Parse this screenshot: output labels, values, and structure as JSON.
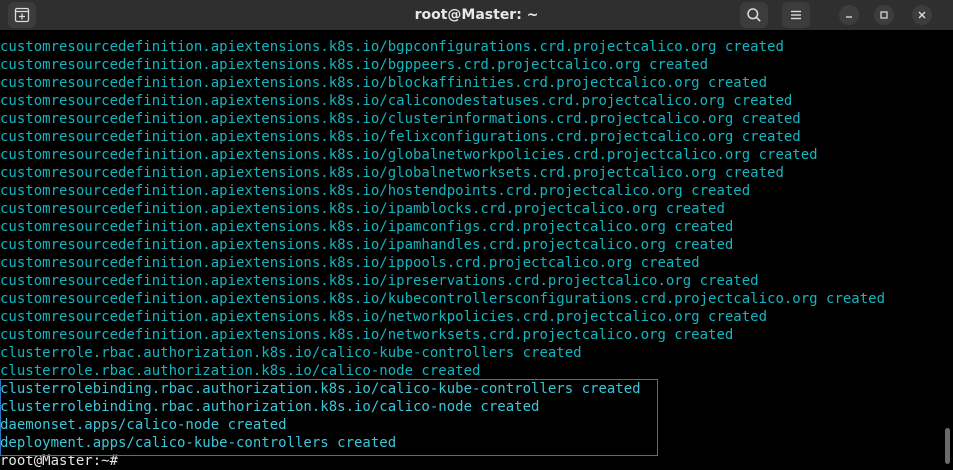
{
  "window": {
    "title": "root@Master: ~"
  },
  "toolbar": {
    "new_tab_icon": "new-tab-icon",
    "search_icon": "search-icon",
    "menu_icon": "hamburger-menu-icon",
    "minimize_icon": "minimize-icon",
    "maximize_icon": "maximize-icon",
    "close_icon": "close-icon"
  },
  "terminal": {
    "lines": [
      "customresourcedefinition.apiextensions.k8s.io/bgpconfigurations.crd.projectcalico.org created",
      "customresourcedefinition.apiextensions.k8s.io/bgppeers.crd.projectcalico.org created",
      "customresourcedefinition.apiextensions.k8s.io/blockaffinities.crd.projectcalico.org created",
      "customresourcedefinition.apiextensions.k8s.io/caliconodestatuses.crd.projectcalico.org created",
      "customresourcedefinition.apiextensions.k8s.io/clusterinformations.crd.projectcalico.org created",
      "customresourcedefinition.apiextensions.k8s.io/felixconfigurations.crd.projectcalico.org created",
      "customresourcedefinition.apiextensions.k8s.io/globalnetworkpolicies.crd.projectcalico.org created",
      "customresourcedefinition.apiextensions.k8s.io/globalnetworksets.crd.projectcalico.org created",
      "customresourcedefinition.apiextensions.k8s.io/hostendpoints.crd.projectcalico.org created",
      "customresourcedefinition.apiextensions.k8s.io/ipamblocks.crd.projectcalico.org created",
      "customresourcedefinition.apiextensions.k8s.io/ipamconfigs.crd.projectcalico.org created",
      "customresourcedefinition.apiextensions.k8s.io/ipamhandles.crd.projectcalico.org created",
      "customresourcedefinition.apiextensions.k8s.io/ippools.crd.projectcalico.org created",
      "customresourcedefinition.apiextensions.k8s.io/ipreservations.crd.projectcalico.org created",
      "customresourcedefinition.apiextensions.k8s.io/kubecontrollersconfigurations.crd.projectcalico.org created",
      "customresourcedefinition.apiextensions.k8s.io/networkpolicies.crd.projectcalico.org created",
      "customresourcedefinition.apiextensions.k8s.io/networksets.crd.projectcalico.org created",
      "clusterrole.rbac.authorization.k8s.io/calico-kube-controllers created",
      "clusterrole.rbac.authorization.k8s.io/calico-node created",
      "clusterrolebinding.rbac.authorization.k8s.io/calico-kube-controllers created",
      "clusterrolebinding.rbac.authorization.k8s.io/calico-node created",
      "daemonset.apps/calico-node created",
      "deployment.apps/calico-kube-controllers created"
    ],
    "prompt": "root@Master:~#"
  },
  "colors": {
    "titlebar": "#2f2f2f",
    "terminal_bg": "#000000",
    "output_text": "#15b5bf",
    "selection_border": "#2f74c5",
    "prompt_text": "#e6e6e6"
  }
}
